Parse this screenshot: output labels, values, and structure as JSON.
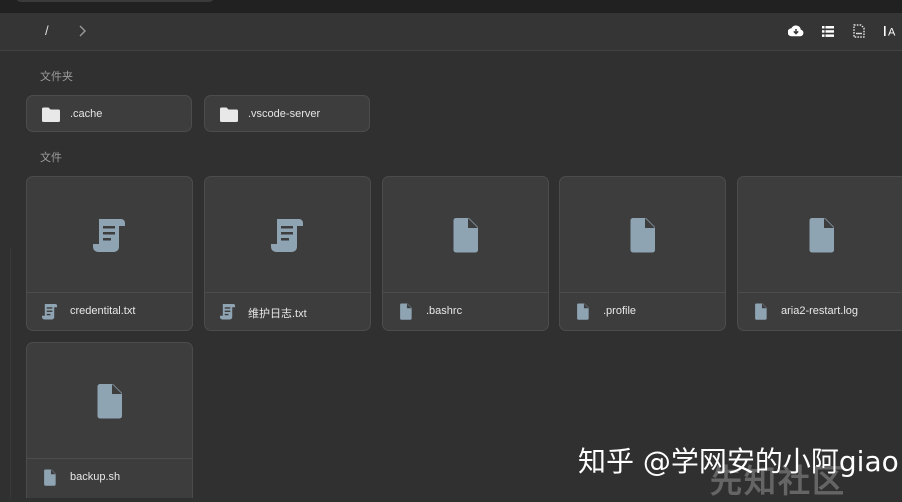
{
  "breadcrumb": {
    "root": "/"
  },
  "toolbar": {
    "icons": [
      "cloud-download-icon",
      "list-view-icon",
      "file-info-icon",
      "text-size-icon"
    ],
    "text_size_label": "A"
  },
  "sections": {
    "folders_label": "文件夹",
    "files_label": "文件"
  },
  "folders": [
    {
      "name": ".cache"
    },
    {
      "name": ".vscode-server"
    }
  ],
  "files": [
    {
      "name": "credentital.txt",
      "icon": "script-icon"
    },
    {
      "name": "维护日志.txt",
      "icon": "script-icon"
    },
    {
      "name": ".bashrc",
      "icon": "file-icon"
    },
    {
      "name": ".profile",
      "icon": "file-icon"
    },
    {
      "name": "aria2-restart.log",
      "icon": "file-icon"
    },
    {
      "name": "backup.sh",
      "icon": "file-icon"
    }
  ],
  "watermark": {
    "text": "知乎 @学网安的小阿giao",
    "logo": "先知社区"
  },
  "colors": {
    "background": "#303030",
    "card": "#3d3d3d",
    "icon": "#8fa4b3"
  }
}
